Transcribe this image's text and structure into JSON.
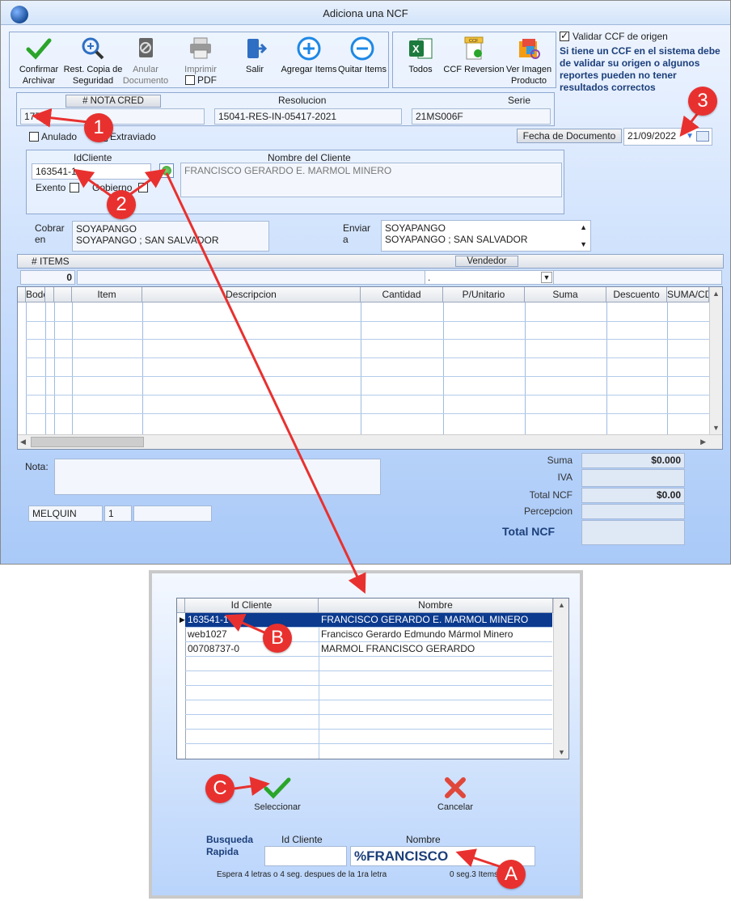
{
  "window": {
    "title": "Adiciona una NCF"
  },
  "toolbar": {
    "confirm": "Confirmar Archivar",
    "restore": "Rest. Copia de Seguridad",
    "void": "Anular Documento",
    "print": "Imprimir",
    "pdf": "PDF",
    "exit": "Salir",
    "add_items": "Agregar Items",
    "remove_items": "Quitar Items",
    "all": "Todos",
    "ccf_reversion": "CCF Reversion",
    "view_image": "Ver Imagen Producto",
    "ccf_icon_text": "CCF"
  },
  "validate": {
    "label": "Validar CCF de origen",
    "checked": true,
    "note": "Si tiene un CCF en el sistema debe de validar su origen o algunos reportes pueden no tener resultados correctos"
  },
  "header": {
    "nota_label": "# NOTA CRED",
    "nota_value": "177",
    "resolucion_label": "Resolucion",
    "resolucion_value": "15041-RES-IN-05417-2021",
    "serie_label": "Serie",
    "serie_value": "21MS006F"
  },
  "flags": {
    "anulado": "Anulado",
    "extraviado": "Extraviado"
  },
  "date": {
    "label": "Fecha de  Documento",
    "value": "21/09/2022"
  },
  "client": {
    "id_label": "IdCliente",
    "id_value": "163541-1",
    "name_label": "Nombre del Cliente",
    "name_value": "FRANCISCO GERARDO E. MARMOL MINERO",
    "exento": "Exento",
    "gobierno": "Gobierno"
  },
  "address": {
    "cobrar_label": "Cobrar en",
    "cobrar_line1": "SOYAPANGO",
    "cobrar_line2": "SOYAPANGO ; SAN SALVADOR",
    "enviar_label": "Enviar a",
    "enviar_line1": "SOYAPANGO",
    "enviar_line2": "SOYAPANGO ; SAN SALVADOR"
  },
  "items": {
    "count_label": "# ITEMS",
    "count_value": "0",
    "vendedor_label": "Vendedor",
    "vendedor_value": "."
  },
  "grid": {
    "columns": [
      "Bodega",
      "Item",
      "Descripcion",
      "Cantidad",
      "P/Unitario",
      "Suma",
      "Descuento",
      "SUMA/CD"
    ]
  },
  "nota": {
    "label": "Nota:"
  },
  "footer": {
    "user": "MELQUIN",
    "station": "1"
  },
  "totals": {
    "suma_label": "Suma",
    "suma_value": "$0.000",
    "iva_label": "IVA",
    "total_label": "Total NCF",
    "total_value": "$0.00",
    "percepcion_label": "Percepcion",
    "grand_label": "Total NCF"
  },
  "dialog": {
    "columns": [
      "Id Cliente",
      "Nombre"
    ],
    "rows": [
      {
        "id": "163541-1",
        "name": "FRANCISCO GERARDO E. MARMOL MINERO",
        "selected": true
      },
      {
        "id": "web1027",
        "name": "Francisco Gerardo Edmundo Mármol Minero",
        "selected": false
      },
      {
        "id": "00708737-0",
        "name": "MARMOL FRANCISCO GERARDO",
        "selected": false
      }
    ],
    "select_label": "Seleccionar",
    "cancel_label": "Cancelar",
    "quick_label": "Busqueda Rapida",
    "id_label": "Id Cliente",
    "name_label": "Nombre",
    "search_value": "%FRANCISCO",
    "hint": "Espera 4 letras o 4 seg. despues de la 1ra letra",
    "status": "0 seg.3 Items"
  },
  "annotations": {
    "b1": "1",
    "b2": "2",
    "b3": "3",
    "bA": "A",
    "bB": "B",
    "bC": "C",
    "color": "#e8312f"
  }
}
